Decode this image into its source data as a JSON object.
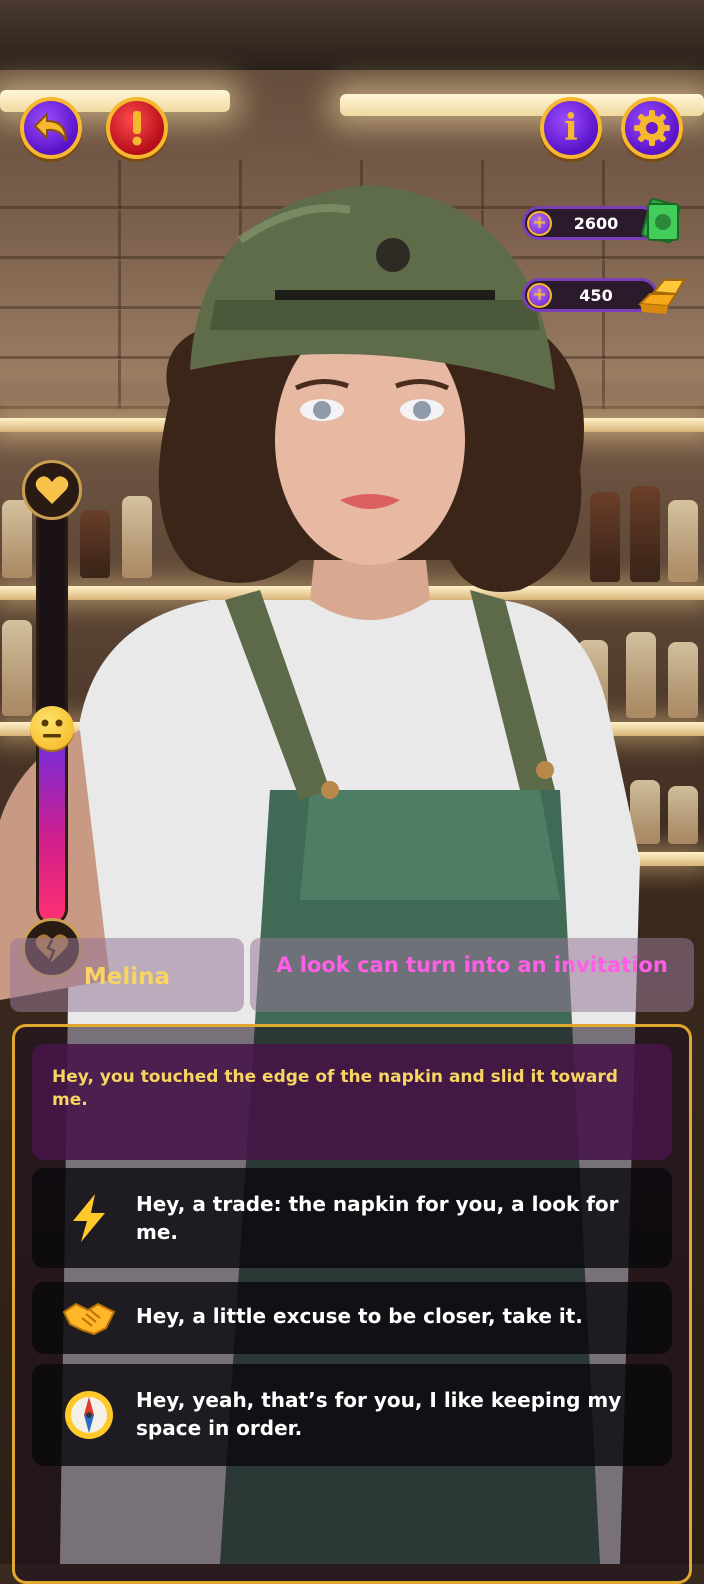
{
  "top_bar": {
    "back_icon": "back-arrow-icon",
    "alert_icon": "exclamation-icon",
    "info_label": "i",
    "settings_icon": "gear-icon"
  },
  "currency": {
    "cash": {
      "amount": "2600",
      "icon": "cash-stack-icon"
    },
    "gold": {
      "amount": "450",
      "icon": "gold-bars-icon"
    }
  },
  "affection": {
    "top_icon": "heart-icon",
    "bottom_icon": "broken-heart-icon",
    "indicator_icon": "neutral-face-icon",
    "level": 0.47
  },
  "character": {
    "name": "Melina",
    "tagline": "A look can turn into an invitation"
  },
  "dialog": {
    "npc_line": "Hey, you touched the edge of the napkin and slid it toward me.",
    "choices": [
      {
        "icon": "lightning-icon",
        "text": "Hey, a trade: the napkin for you, a look for me."
      },
      {
        "icon": "handshake-icon",
        "text": "Hey, a little excuse to be closer, take it."
      },
      {
        "icon": "compass-icon",
        "text": "Hey, yeah, that’s for you, I like keeping my space in order."
      }
    ]
  },
  "colors": {
    "accent_gold": "#f5b82e",
    "button_purple": "#6a1cc8",
    "name_yellow": "#f7d560",
    "tagline_pink": "#ff5ee6",
    "npc_box_purple": "#46144a"
  }
}
